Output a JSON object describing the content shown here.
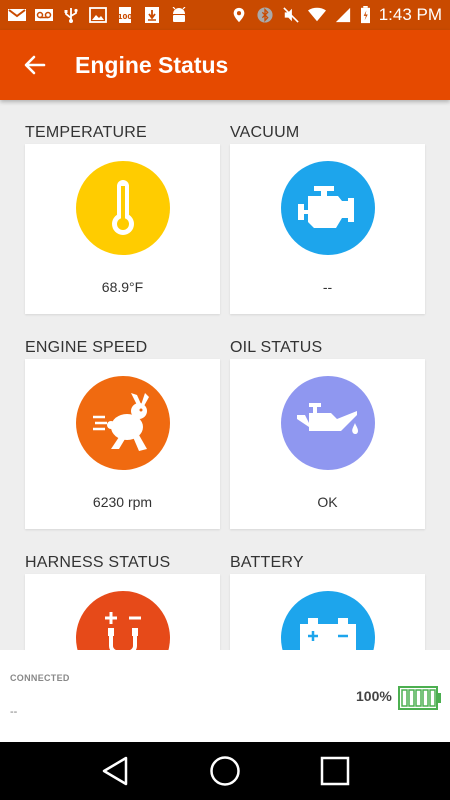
{
  "status_bar": {
    "time": "1:43 PM",
    "icons": [
      "gmail-icon",
      "voicemail-icon",
      "usb-icon",
      "image-icon",
      "100-icon",
      "download-icon",
      "android-icon",
      "location-icon",
      "bluetooth-icon",
      "mute-icon",
      "wifi-icon",
      "signal-icon",
      "battery-charging-icon"
    ]
  },
  "app_bar": {
    "title": "Engine Status",
    "back_icon": "arrow-left-icon"
  },
  "colors": {
    "status_bar": "#c94a00",
    "app_bar": "#e64a00",
    "temperature": "#ffcc00",
    "vacuum": "#1da5ec",
    "engine_speed": "#f06a10",
    "oil_status": "#8f97f0",
    "harness": "#e64a19",
    "battery": "#1da5ec",
    "battery_indicator": "#4caf50"
  },
  "cards": [
    {
      "label": "TEMPERATURE",
      "value": "68.9°F",
      "icon": "thermometer-icon"
    },
    {
      "label": "VACUUM",
      "value": "--",
      "icon": "engine-icon"
    },
    {
      "label": "ENGINE SPEED",
      "value": "6230 rpm",
      "icon": "rabbit-icon"
    },
    {
      "label": "OIL STATUS",
      "value": "OK",
      "icon": "oil-can-icon"
    },
    {
      "label": "HARNESS STATUS",
      "value": "",
      "icon": "harness-icon"
    },
    {
      "label": "BATTERY",
      "value": "",
      "icon": "car-battery-icon"
    }
  ],
  "bottom": {
    "connected_label": "CONNECTED",
    "connected_value": "--",
    "battery_percent": "100%",
    "battery_level": 1.0
  },
  "nav": [
    "back-icon",
    "home-icon",
    "recents-icon"
  ]
}
